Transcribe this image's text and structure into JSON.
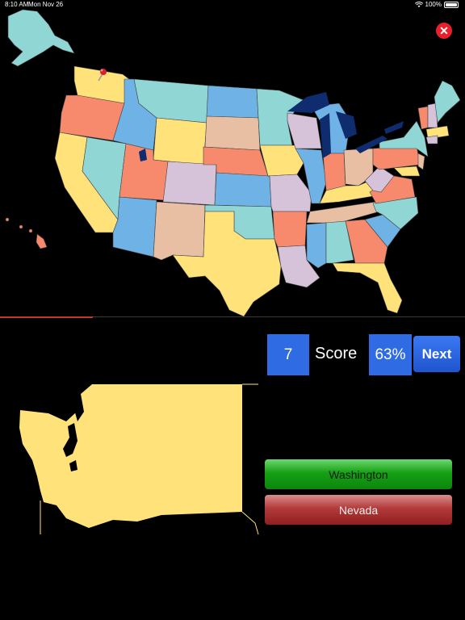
{
  "status_bar": {
    "time": "8:10 AM",
    "date": "Mon Nov 26",
    "battery": "100%",
    "icons": [
      "wifi-icon",
      "battery-icon"
    ]
  },
  "close_button": {
    "icon": "close-icon",
    "glyph": "✕",
    "color": "#e8202a"
  },
  "map": {
    "title": "",
    "pin_state": "Washington",
    "colors": {
      "yellow": "#ffe27a",
      "cyan": "#8fd6d4",
      "blue": "#6fb2e5",
      "orange": "#f78a6c",
      "tan": "#e8bfa3",
      "lavender": "#d6c2d9",
      "lakes": "#0e2c6e",
      "pin": "#d42030"
    }
  },
  "progress": {
    "fraction": 0.2
  },
  "score": {
    "count": "7",
    "label": "Score",
    "percent": "63%",
    "box_color": "#2f6be3"
  },
  "next_button": {
    "label": "Next"
  },
  "quiz": {
    "shape_color": "#ffe27a",
    "answers": [
      {
        "label": "Washington",
        "status": "correct",
        "color": "#15a015"
      },
      {
        "label": "Nevada",
        "status": "wrong",
        "color": "#b33a3a"
      }
    ]
  }
}
